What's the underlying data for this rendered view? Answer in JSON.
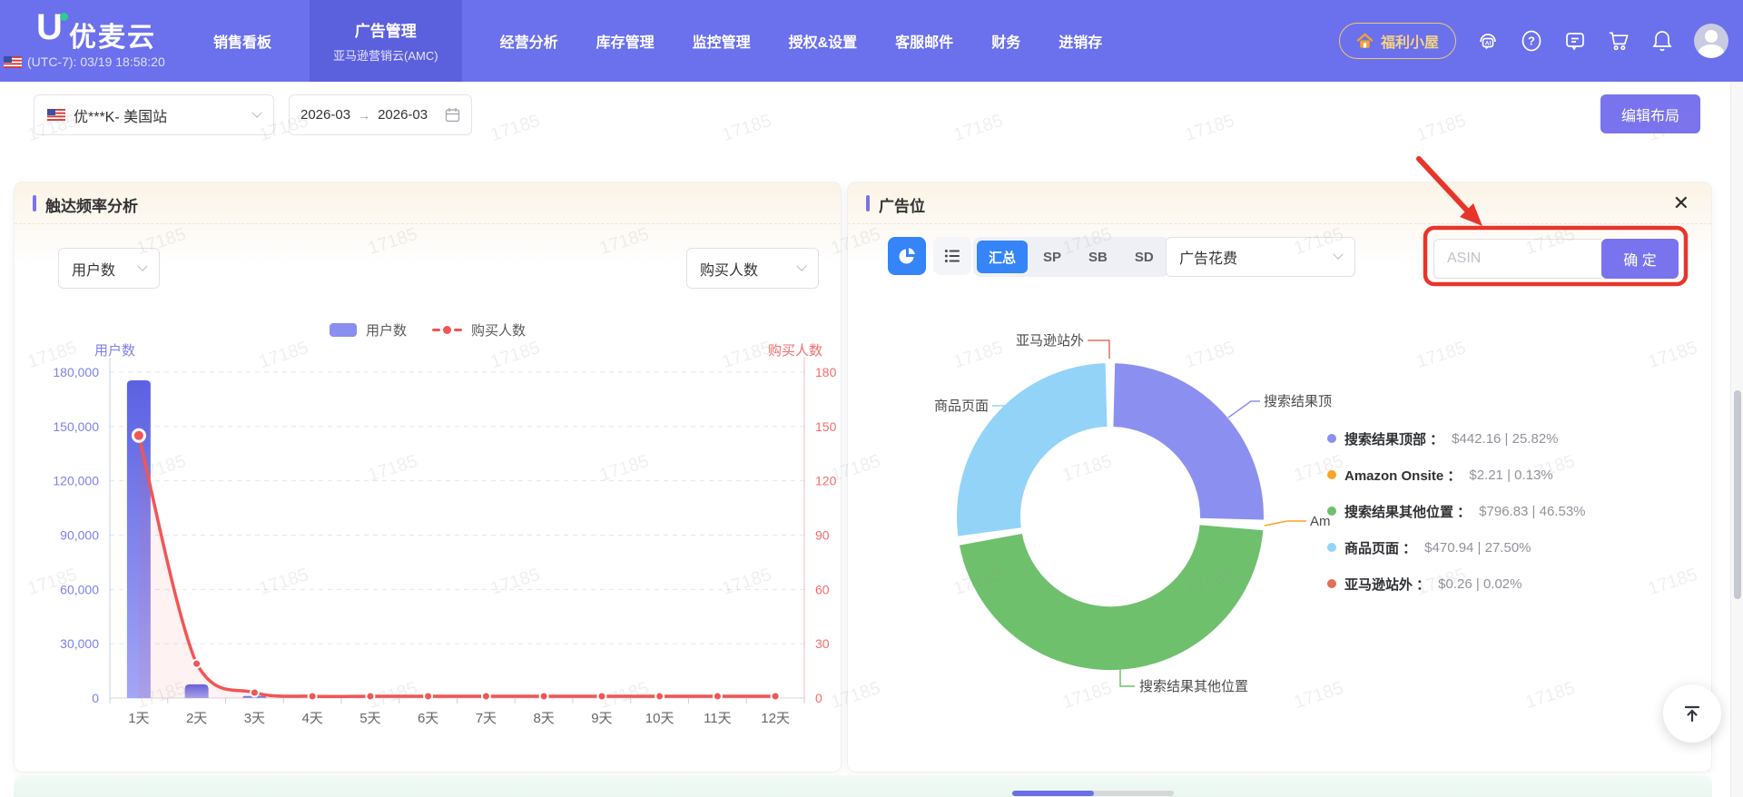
{
  "navbar": {
    "logo_text": "优麦云",
    "timezone_label": "(UTC-7): 03/19 18:58:20",
    "items": [
      {
        "label": "销售看板"
      },
      {
        "label": "广告管理",
        "sublabel": "亚马逊营销云(AMC)",
        "active": true
      },
      {
        "label": "经营分析"
      },
      {
        "label": "库存管理"
      },
      {
        "label": "监控管理"
      },
      {
        "label": "授权&设置"
      },
      {
        "label": "客服邮件"
      },
      {
        "label": "财务"
      },
      {
        "label": "进销存"
      }
    ],
    "welfare_button": "福利小屋",
    "icons": [
      "ai-assistant-icon",
      "help-icon",
      "feedback-icon",
      "cart-icon",
      "bell-icon",
      "avatar"
    ]
  },
  "filter_bar": {
    "store": "优***K- 美国站",
    "date_start": "2026-03",
    "date_arrow": "→",
    "date_end": "2026-03",
    "edit_layout_button": "编辑布局"
  },
  "left_panel": {
    "title": "触达频率分析",
    "primary_select": "用户数",
    "secondary_select": "购买人数",
    "left_axis_title": "用户数",
    "right_axis_title": "购买人数",
    "legend": [
      {
        "label": "用户数"
      },
      {
        "label": "购买人数"
      }
    ],
    "chart_data": {
      "type": "bar+line-dual-axis",
      "categories": [
        "1天",
        "2天",
        "3天",
        "4天",
        "5天",
        "6天",
        "7天",
        "8天",
        "9天",
        "10天",
        "11天",
        "12天"
      ],
      "series": [
        {
          "name": "用户数",
          "type": "bar",
          "axis": "left",
          "color_top": "#5c61e2",
          "color_bottom": "#a3a6f5",
          "values": [
            175500,
            7600,
            1100,
            0,
            0,
            0,
            0,
            0,
            0,
            0,
            0,
            0
          ]
        },
        {
          "name": "购买人数",
          "type": "line",
          "axis": "right",
          "color": "#f25555",
          "area_fill": "rgba(242,85,85,0.08)",
          "values": [
            145,
            19,
            3,
            1,
            1,
            1,
            1,
            1,
            1,
            1,
            1,
            1
          ]
        }
      ],
      "left_axis": {
        "title": "用户数",
        "max": 180000,
        "color": "#7c80ee",
        "ticks": [
          "180,000",
          "150,000",
          "120,000",
          "90,000",
          "60,000",
          "30,000",
          "0"
        ]
      },
      "right_axis": {
        "title": "购买人数",
        "max": 180,
        "color": "#f56c6c",
        "ticks": [
          "180",
          "150",
          "120",
          "90",
          "60",
          "30",
          "0"
        ]
      },
      "grid": true
    }
  },
  "right_panel": {
    "title": "广告位",
    "close_icon": "✕",
    "view_tabs": [
      "汇总",
      "SP",
      "SB",
      "SD"
    ],
    "active_tab": "汇总",
    "metric_select": "广告花费",
    "asin_placeholder": "ASIN",
    "confirm_button": "确 定",
    "chart_data": {
      "type": "pie",
      "legend_position": "right",
      "slices": [
        {
          "name": "搜索结果顶部",
          "value": 442.16,
          "pct": 25.82,
          "color": "#8b90f0",
          "callout": "搜索结果顶",
          "legend_label": "搜索结果顶部 ：",
          "value_label": "$442.16 | 25.82%"
        },
        {
          "name": "Amazon Onsite",
          "value": 2.21,
          "pct": 0.13,
          "color": "#f6a623",
          "callout": "Am",
          "legend_label": "Amazon Onsite ：",
          "value_label": "$2.21 | 0.13%"
        },
        {
          "name": "搜索结果其他位置",
          "value": 796.83,
          "pct": 46.53,
          "color": "#6fc06d",
          "callout": "搜索结果其他位置",
          "legend_label": "搜索结果其他位置 ：",
          "value_label": "$796.83 | 46.53%"
        },
        {
          "name": "商品页面",
          "value": 470.94,
          "pct": 27.5,
          "color": "#93d3f8",
          "callout": "商品页面",
          "legend_label": "商品页面 ：",
          "value_label": "$470.94 | 27.50%"
        },
        {
          "name": "亚马逊站外",
          "value": 0.26,
          "pct": 0.02,
          "color": "#e0705a",
          "callout": "亚马逊站外",
          "legend_label": "亚马逊站外 ：",
          "value_label": "$0.26 | 0.02%"
        }
      ]
    }
  },
  "watermark": "17185",
  "colors": {
    "nav_bg": "#6b70ec",
    "nav_active_bg": "#5b60dc",
    "accent_purple": "#7a73ee",
    "active_blue": "#3584f8",
    "annotation_red": "#e8352c",
    "gold": "#f6d483"
  }
}
